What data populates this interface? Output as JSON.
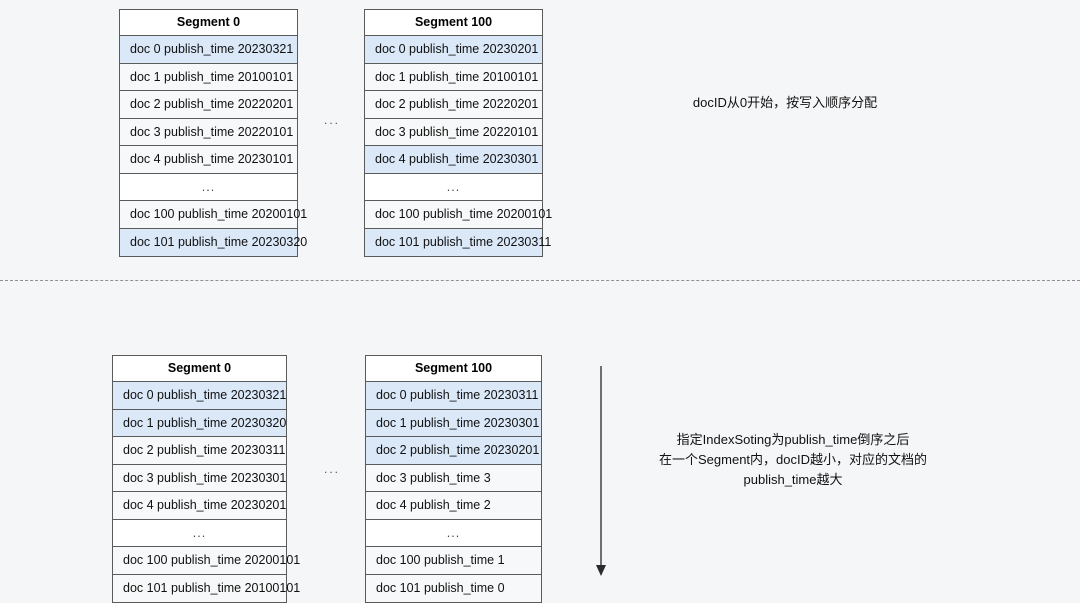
{
  "page": {
    "background_color": "#f5f6f8",
    "highlight_color": "#dbe8f8",
    "border_color": "#5a5a5a",
    "divider_color": "#8f8f96",
    "arrow_color": "#6e6e76"
  },
  "top_section": {
    "segments": [
      {
        "title": "Segment 0",
        "rows": [
          {
            "text": "doc 0 publish_time 20230321",
            "highlight": true
          },
          {
            "text": "doc 1  publish_time 20100101",
            "highlight": false
          },
          {
            "text": "doc 2  publish_time 20220201",
            "highlight": false
          },
          {
            "text": "doc 3  publish_time 20220101",
            "highlight": false
          },
          {
            "text": "doc 4  publish_time 20230101",
            "highlight": false
          },
          {
            "text": "...",
            "highlight": false,
            "ellipsis": true
          },
          {
            "text": "doc 100  publish_time 20200101",
            "highlight": false
          },
          {
            "text": "doc 101  publish_time 20230320",
            "highlight": true
          }
        ]
      },
      {
        "title": "Segment 100",
        "rows": [
          {
            "text": "doc 0 publish_time 20230201",
            "highlight": true
          },
          {
            "text": "doc 1  publish_time 20100101",
            "highlight": false
          },
          {
            "text": "doc 2  publish_time 20220201",
            "highlight": false
          },
          {
            "text": "doc 3  publish_time 20220101",
            "highlight": false
          },
          {
            "text": "doc 4  publish_time 20230301",
            "highlight": true
          },
          {
            "text": "...",
            "highlight": false,
            "ellipsis": true
          },
          {
            "text": "doc 100  publish_time 20200101",
            "highlight": false
          },
          {
            "text": "doc 101  publish_time 20230311",
            "highlight": true
          }
        ]
      }
    ],
    "between_segments_ellipsis": "...",
    "note": "docID从0开始，按写入顺序分配"
  },
  "bottom_section": {
    "segments": [
      {
        "title": "Segment 0",
        "rows": [
          {
            "text": "doc 0  publish_time 20230321",
            "highlight": true
          },
          {
            "text": "doc 1  publish_time 20230320",
            "highlight": true
          },
          {
            "text": "doc 2  publish_time 20230311",
            "highlight": false
          },
          {
            "text": "doc 3  publish_time 20230301",
            "highlight": false
          },
          {
            "text": "doc 4  publish_time 20230201",
            "highlight": false
          },
          {
            "text": "...",
            "highlight": false,
            "ellipsis": true
          },
          {
            "text": "doc 100  publish_time 20200101",
            "highlight": false
          },
          {
            "text": "doc 101  publish_time 20100101",
            "highlight": false
          }
        ]
      },
      {
        "title": "Segment 100",
        "rows": [
          {
            "text": "doc 0  publish_time 20230311",
            "highlight": true
          },
          {
            "text": "doc 1  publish_time 20230301",
            "highlight": true
          },
          {
            "text": "doc 2  publish_time 20230201",
            "highlight": true
          },
          {
            "text": "doc 3  publish_time 3",
            "highlight": false
          },
          {
            "text": "doc 4  publish_time 2",
            "highlight": false
          },
          {
            "text": "...",
            "highlight": false,
            "ellipsis": true
          },
          {
            "text": "doc 100  publish_time 1",
            "highlight": false
          },
          {
            "text": "doc 101  publish_time 0",
            "highlight": false
          }
        ]
      }
    ],
    "between_segments_ellipsis": "...",
    "note": "指定IndexSoting为publish_time倒序之后\n在一个Segment内，docID越小，对应的文档的\npublish_time越大"
  }
}
